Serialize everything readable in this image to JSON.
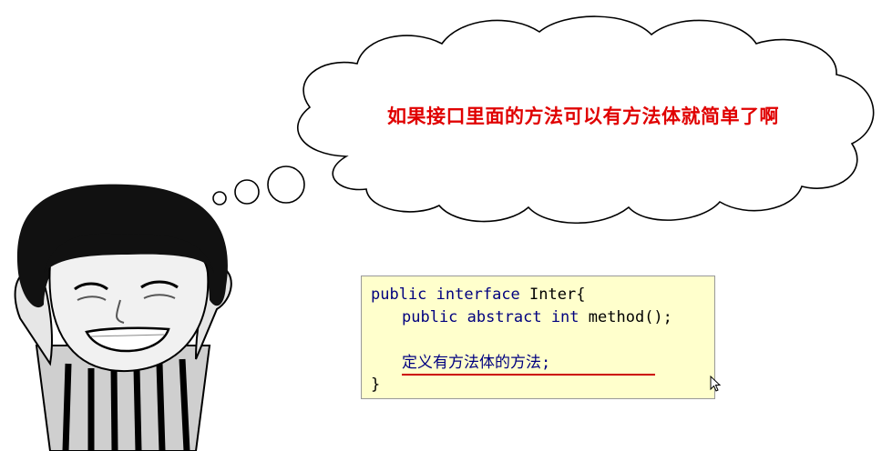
{
  "thought_bubble": {
    "text": "如果接口里面的方法可以有方法体就简单了啊"
  },
  "code": {
    "line1": {
      "kw1": "public",
      "kw2": "interface",
      "name": "Inter{"
    },
    "line2": {
      "kw1": "public",
      "kw2": "abstract",
      "kw3": "int",
      "name": "method();"
    },
    "line3": {
      "comment": "定义有方法体的方法;"
    },
    "line4": {
      "brace": "}"
    }
  },
  "colors": {
    "bubble_text": "#e00000",
    "code_background": "#ffffcc",
    "keyword": "#00007f",
    "underline": "#cc0000"
  }
}
